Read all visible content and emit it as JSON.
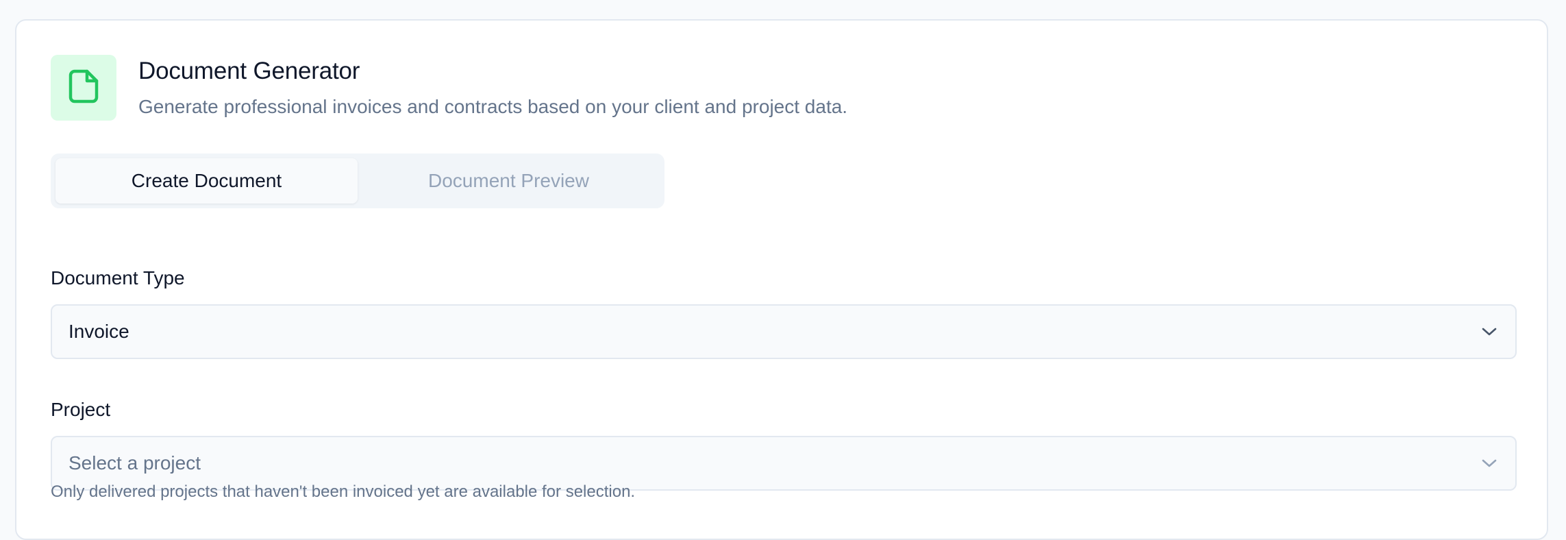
{
  "header": {
    "title": "Document Generator",
    "subtitle": "Generate professional invoices and contracts based on your client and project data.",
    "icon": "file-icon",
    "accent_color": "#22c55e",
    "icon_bg_color": "#dcfce7"
  },
  "tabs": [
    {
      "label": "Create Document",
      "active": true
    },
    {
      "label": "Document Preview",
      "active": false
    }
  ],
  "form": {
    "document_type": {
      "label": "Document Type",
      "value": "Invoice"
    },
    "project": {
      "label": "Project",
      "placeholder": "Select a project",
      "helper": "Only delivered projects that haven't been invoiced yet are available for selection."
    }
  }
}
